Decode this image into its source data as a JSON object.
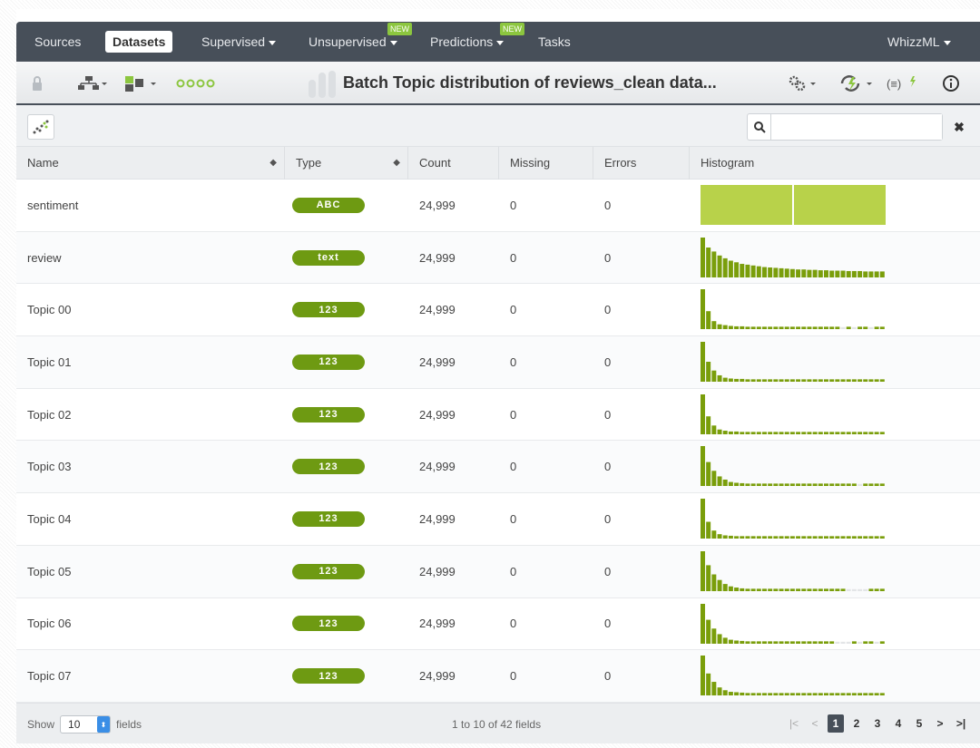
{
  "nav": {
    "items": [
      {
        "label": "Sources",
        "active": false,
        "caret": false,
        "new": false
      },
      {
        "label": "Datasets",
        "active": true,
        "caret": false,
        "new": false
      },
      {
        "label": "Supervised",
        "active": false,
        "caret": true,
        "new": false
      },
      {
        "label": "Unsupervised",
        "active": false,
        "caret": true,
        "new": true
      },
      {
        "label": "Predictions",
        "active": false,
        "caret": true,
        "new": true
      },
      {
        "label": "Tasks",
        "active": false,
        "caret": false,
        "new": false
      }
    ],
    "new_badge": "NEW",
    "right_label": "WhizzML"
  },
  "toolbar": {
    "title": "Batch Topic distribution of reviews_clean data...",
    "icons": [
      "lock-icon",
      "tree-icon",
      "field-icon",
      "dots-icon",
      "gear-icon",
      "lightning-icon",
      "formula-icon",
      "info-icon"
    ]
  },
  "search": {
    "placeholder": "",
    "value": ""
  },
  "table": {
    "headers": [
      "Name",
      "Type",
      "Count",
      "Missing",
      "Errors",
      "Histogram"
    ],
    "rows": [
      {
        "name": "sentiment",
        "type": "ABC",
        "count": "24,999",
        "missing": "0",
        "errors": "0",
        "hist": [
          1,
          1
        ]
      },
      {
        "name": "review",
        "type": "text",
        "count": "24,999",
        "missing": "0",
        "errors": "0",
        "hist": [
          1.0,
          0.75,
          0.65,
          0.55,
          0.48,
          0.42,
          0.38,
          0.34,
          0.32,
          0.3,
          0.28,
          0.26,
          0.25,
          0.24,
          0.23,
          0.22,
          0.21,
          0.2,
          0.2,
          0.19,
          0.19,
          0.18,
          0.18,
          0.17,
          0.17,
          0.17,
          0.16,
          0.16,
          0.16,
          0.15,
          0.15,
          0.15,
          0.15
        ]
      },
      {
        "name": "Topic 00",
        "type": "123",
        "count": "24,999",
        "missing": "0",
        "errors": "0",
        "hist": [
          1.0,
          0.45,
          0.2,
          0.12,
          0.1,
          0.08,
          0.07,
          0.07,
          0.06,
          0.06,
          0.06,
          0.06,
          0.06,
          0.06,
          0.06,
          0.06,
          0.06,
          0.06,
          0.06,
          0.06,
          0.06,
          0.06,
          0.06,
          0.06,
          0.06,
          0.0,
          0.06,
          0.0,
          0.06,
          0.06,
          0.0,
          0.06,
          0.06
        ]
      },
      {
        "name": "Topic 01",
        "type": "123",
        "count": "24,999",
        "missing": "0",
        "errors": "0",
        "hist": [
          1.0,
          0.5,
          0.28,
          0.16,
          0.1,
          0.08,
          0.07,
          0.07,
          0.06,
          0.06,
          0.06,
          0.06,
          0.06,
          0.06,
          0.06,
          0.06,
          0.06,
          0.06,
          0.06,
          0.06,
          0.06,
          0.06,
          0.06,
          0.06,
          0.06,
          0.06,
          0.06,
          0.06,
          0.06,
          0.06,
          0.06,
          0.06,
          0.06
        ]
      },
      {
        "name": "Topic 02",
        "type": "123",
        "count": "24,999",
        "missing": "0",
        "errors": "0",
        "hist": [
          1.0,
          0.45,
          0.22,
          0.12,
          0.09,
          0.07,
          0.07,
          0.06,
          0.06,
          0.06,
          0.06,
          0.06,
          0.06,
          0.06,
          0.06,
          0.06,
          0.06,
          0.06,
          0.06,
          0.06,
          0.06,
          0.06,
          0.06,
          0.06,
          0.06,
          0.06,
          0.06,
          0.06,
          0.06,
          0.06,
          0.06,
          0.06,
          0.06
        ]
      },
      {
        "name": "Topic 03",
        "type": "123",
        "count": "24,999",
        "missing": "0",
        "errors": "0",
        "hist": [
          1.0,
          0.6,
          0.38,
          0.24,
          0.16,
          0.1,
          0.08,
          0.07,
          0.06,
          0.06,
          0.06,
          0.06,
          0.06,
          0.06,
          0.06,
          0.06,
          0.06,
          0.06,
          0.06,
          0.06,
          0.06,
          0.06,
          0.06,
          0.06,
          0.06,
          0.06,
          0.06,
          0.06,
          0.0,
          0.06,
          0.06,
          0.06,
          0.06
        ]
      },
      {
        "name": "Topic 04",
        "type": "123",
        "count": "24,999",
        "missing": "0",
        "errors": "0",
        "hist": [
          1.0,
          0.42,
          0.2,
          0.11,
          0.08,
          0.07,
          0.06,
          0.06,
          0.06,
          0.06,
          0.06,
          0.06,
          0.06,
          0.06,
          0.06,
          0.06,
          0.06,
          0.06,
          0.06,
          0.06,
          0.06,
          0.06,
          0.06,
          0.06,
          0.06,
          0.06,
          0.06,
          0.06,
          0.06,
          0.06,
          0.06,
          0.06,
          0.06
        ]
      },
      {
        "name": "Topic 05",
        "type": "123",
        "count": "24,999",
        "missing": "0",
        "errors": "0",
        "hist": [
          1.0,
          0.65,
          0.42,
          0.28,
          0.18,
          0.12,
          0.09,
          0.07,
          0.06,
          0.06,
          0.06,
          0.06,
          0.06,
          0.06,
          0.06,
          0.06,
          0.06,
          0.06,
          0.06,
          0.06,
          0.06,
          0.06,
          0.06,
          0.06,
          0.06,
          0.06,
          0.0,
          0.0,
          0.0,
          0.0,
          0.06,
          0.06,
          0.06
        ]
      },
      {
        "name": "Topic 06",
        "type": "123",
        "count": "24,999",
        "missing": "0",
        "errors": "0",
        "hist": [
          1.0,
          0.6,
          0.38,
          0.24,
          0.15,
          0.1,
          0.08,
          0.07,
          0.06,
          0.06,
          0.06,
          0.06,
          0.06,
          0.06,
          0.06,
          0.06,
          0.06,
          0.06,
          0.06,
          0.06,
          0.06,
          0.06,
          0.06,
          0.06,
          0.0,
          0.0,
          0.0,
          0.06,
          0.0,
          0.06,
          0.06,
          0.0,
          0.06
        ]
      },
      {
        "name": "Topic 07",
        "type": "123",
        "count": "24,999",
        "missing": "0",
        "errors": "0",
        "hist": [
          1.0,
          0.55,
          0.34,
          0.2,
          0.13,
          0.09,
          0.08,
          0.07,
          0.06,
          0.06,
          0.06,
          0.06,
          0.06,
          0.06,
          0.06,
          0.06,
          0.06,
          0.06,
          0.06,
          0.06,
          0.06,
          0.06,
          0.06,
          0.06,
          0.06,
          0.06,
          0.06,
          0.06,
          0.06,
          0.06,
          0.06,
          0.06,
          0.06
        ]
      }
    ]
  },
  "footer": {
    "show_label": "Show",
    "show_value": "10",
    "fields_label": "fields",
    "range": "1 to 10 of 42 fields",
    "pages": [
      "1",
      "2",
      "3",
      "4",
      "5"
    ],
    "active_page": "1"
  },
  "colors": {
    "nav_bg": "#474f59",
    "accent_green": "#8cc63f",
    "type_green": "#6e9a12",
    "hist_green": "#7a9e0b",
    "hist_light": "#b8d24a"
  }
}
